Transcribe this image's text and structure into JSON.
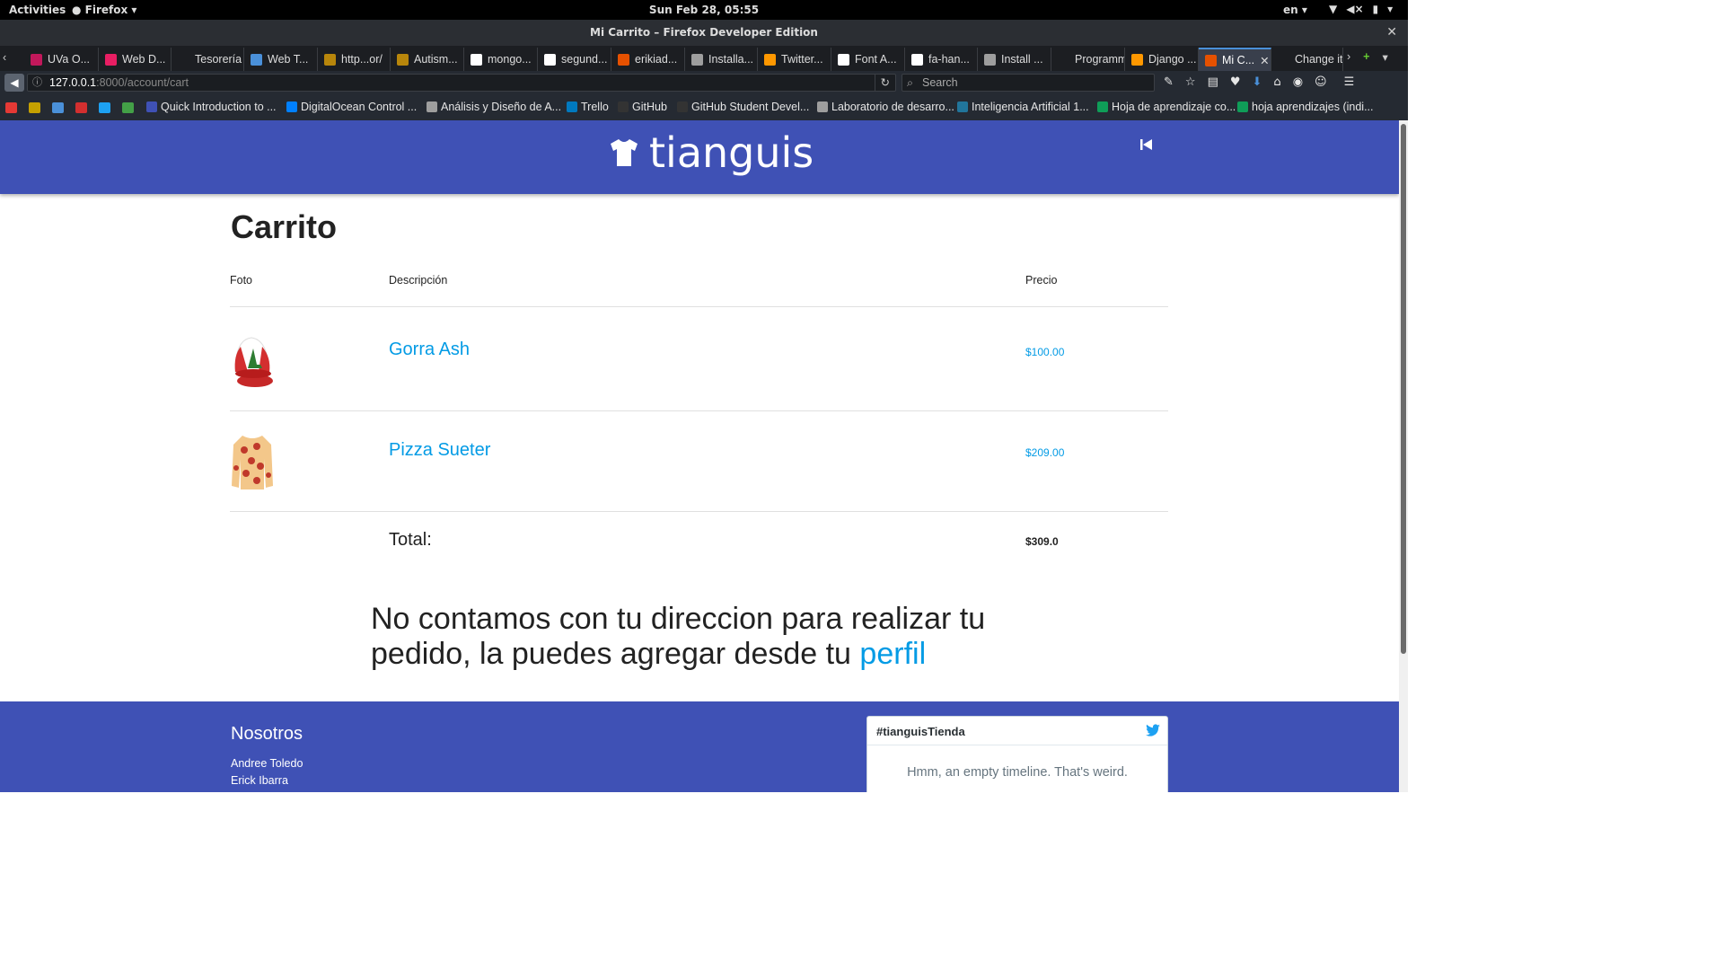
{
  "system_bar": {
    "activities": "Activities",
    "app_menu": "Firefox",
    "clock": "Sun Feb 28, 05:55",
    "language": "en"
  },
  "window": {
    "title": "Mi Carrito – Firefox Developer Edition"
  },
  "tabs": [
    {
      "label": "UVa O...",
      "color": "#c2185b"
    },
    {
      "label": "Web D...",
      "color": "#e91e63"
    },
    {
      "label": "Tesorería",
      "color": "#00000000"
    },
    {
      "label": "Web T...",
      "color": "#4a90d9"
    },
    {
      "label": "http...or/",
      "color": "#b8860b"
    },
    {
      "label": "Autism...",
      "color": "#b8860b"
    },
    {
      "label": "mongo...",
      "color": "#ffffff"
    },
    {
      "label": "segund...",
      "color": "#ffffff"
    },
    {
      "label": "erikiad...",
      "color": "#e65100"
    },
    {
      "label": "Installa...",
      "color": "#9e9e9e"
    },
    {
      "label": "Twitter...",
      "color": "#ff9800"
    },
    {
      "label": "Font A...",
      "color": "#ffffff"
    },
    {
      "label": "fa-han...",
      "color": "#ffffff"
    },
    {
      "label": "Install ...",
      "color": "#9e9e9e"
    },
    {
      "label": "Programmi...",
      "color": "#00000000"
    },
    {
      "label": "Django ...",
      "color": "#ff9800"
    },
    {
      "label": "Mi C...",
      "color": "#e65100",
      "active": true
    },
    {
      "label": "Change ite...",
      "color": "#00000000"
    }
  ],
  "navbar": {
    "url_host": "127.0.0.1",
    "url_path": ":8000/account/cart",
    "search_placeholder": "Search"
  },
  "bookmarks": [
    {
      "label": "Quick Introduction to ...",
      "color": "#3f51b5"
    },
    {
      "label": "DigitalOcean Control ...",
      "color": "#0080ff"
    },
    {
      "label": "Análisis y Diseño de A...",
      "color": "#9e9e9e"
    },
    {
      "label": "Trello",
      "color": "#0079bf"
    },
    {
      "label": "GitHub",
      "color": "#333333"
    },
    {
      "label": "GitHub Student Devel...",
      "color": "#333333"
    },
    {
      "label": "Laboratorio de desarro...",
      "color": "#9e9e9e"
    },
    {
      "label": "Inteligencia Artificial 1...",
      "color": "#21759b"
    },
    {
      "label": "Hoja de aprendizaje co...",
      "color": "#0f9d58"
    },
    {
      "label": "hoja aprendizajes (indi...",
      "color": "#0f9d58"
    }
  ],
  "site": {
    "brand": "tianguis",
    "brand_color": "#3f51b5",
    "link_color": "#039be5"
  },
  "cart": {
    "title": "Carrito",
    "headers": {
      "photo": "Foto",
      "description": "Descripción",
      "price": "Precio"
    },
    "items": [
      {
        "name": "Gorra Ash",
        "price": "$100.00",
        "image": "red-cap"
      },
      {
        "name": "Pizza Sueter",
        "price": "$209.00",
        "image": "pizza-sweater"
      }
    ],
    "total_label": "Total:",
    "total_value": "$309.0"
  },
  "notice": {
    "text": "No contamos con tu direccion para realizar tu pedido, la puedes agregar desde tu ",
    "link": "perfil"
  },
  "footer": {
    "heading": "Nosotros",
    "members": [
      "Andree Toledo",
      "Erick Ibarra"
    ],
    "twitter": {
      "handle": "#tianguisTienda",
      "empty_message": "Hmm, an empty timeline. That's weird."
    }
  }
}
